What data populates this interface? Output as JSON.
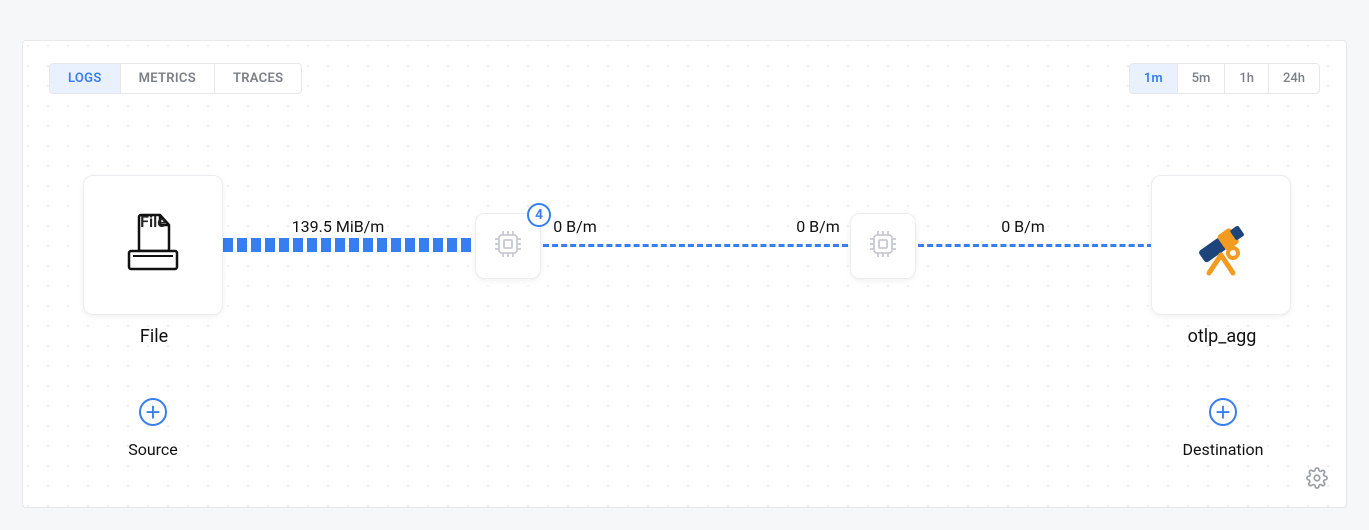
{
  "type_tabs": {
    "items": [
      "LOGS",
      "METRICS",
      "TRACES"
    ],
    "active": "LOGS"
  },
  "time_tabs": {
    "items": [
      "1m",
      "5m",
      "1h",
      "24h"
    ],
    "active": "1m"
  },
  "pipeline": {
    "source": {
      "label": "File"
    },
    "destination": {
      "label": "otlp_agg"
    },
    "processors": [
      {
        "badge": 4
      },
      {
        "badge": null
      }
    ],
    "edges": [
      {
        "label": "139.5 MiB/m"
      },
      {
        "label": "0 B/m"
      },
      {
        "label": "0 B/m"
      },
      {
        "label": "0 B/m"
      }
    ]
  },
  "actions": {
    "add_source": "Source",
    "add_destination": "Destination"
  }
}
